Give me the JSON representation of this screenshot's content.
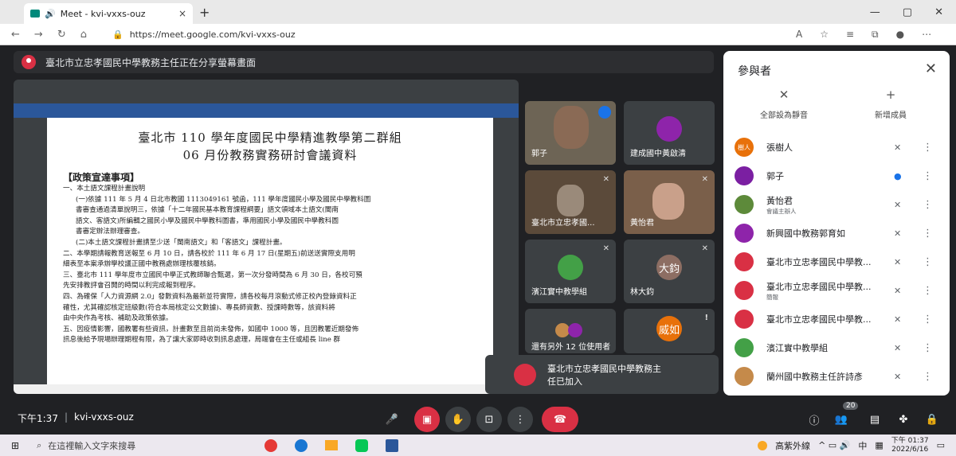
{
  "browser": {
    "tab_title": "Meet - kvi-vxxs-ouz",
    "url": "https://meet.google.com/kvi-vxxs-ouz"
  },
  "banner": {
    "text": "臺北市立忠孝國民中學教務主任正在分享螢幕畫面"
  },
  "document": {
    "title1": "臺北市 110 學年度國民中學精進教學第二群組",
    "title2": "06 月份教務實務研討會議資料",
    "heading": "【政策宣達事項】",
    "lines": [
      "一、本土語文課程計畫說明",
      "(一)依據 111 年 5 月 4 日北市教國 1113049161 號函，111 學年度國民小學及國民中學教科圖",
      "書審查通過清單說明三，依據「十二年國民基本教育課程綱要」語文領域本土語文(閩南",
      "語文、客語文)所編輯之國民小學及國民中學教科圖書，準用國民小學及國民中學教科圖",
      "書審定辦法辦理審查。",
      "(二)本土語文課程計畫請至少送「閩南語文」和「客語文」課程計畫。",
      "二、本學期請報教育送報至 6 月 10 日，請各校於 111 年 6 月 17 日(星期五)前送送實際支用明",
      "細表至本案承辦學校議正國中教務處辦理核覆核銷。",
      "三、臺北市 111 學年度市立國民中學正式教師聯合甄選，第一次分發時間為 6 月 30 日，各校可預",
      "先安排教評會召開的時間以利完成報到程序。",
      "四、為確保「人力資源網 2.0」發數資料為最新並符實際，請各校每月滾動式修正校內登錄資料正",
      "確性，尤其確認核定班級數(符合本局核定公文數據)、專長師資數、授課時數等，該資料將",
      "由中央作為考核、補助及政策依據。",
      "五、因疫情影響，國教署有些資訊，計畫數至且前尚未發佈，如國中 1000 等，且因教署近期發佈",
      "訊息後給予現場辦理期程有限，為了讓大家即時收到訊息處理，局端會在主任或組長 line 群"
    ]
  },
  "tiles": [
    {
      "name": "郭子",
      "avatar": ""
    },
    {
      "name": "建成國中黃啟清",
      "avatar": ""
    },
    {
      "name": "臺北市立忠孝國...",
      "avatar": ""
    },
    {
      "name": "黃怡君",
      "avatar": ""
    },
    {
      "name": "濱江實中教學組",
      "avatar": ""
    },
    {
      "name": "林大鈞",
      "avatar": "大鈞"
    },
    {
      "name": "還有另外 12 位使用者",
      "avatar": ""
    },
    {
      "name": "",
      "avatar": "威如"
    }
  ],
  "toast": {
    "text1": "臺北市立忠孝國民中學教務主",
    "text2": "任已加入"
  },
  "panel": {
    "title": "參與者",
    "mute_all": "全部設為靜音",
    "add_member": "新增成員",
    "participants": [
      {
        "name": "張樹人",
        "sub": "",
        "avatar": "樹人",
        "color": "#e8710a"
      },
      {
        "name": "郭子",
        "sub": "",
        "avatar": "",
        "color": "#7b1fa2"
      },
      {
        "name": "黃怡君",
        "sub": "會議主辦人",
        "avatar": "",
        "color": "#5d8a3a"
      },
      {
        "name": "新興國中教務郭育如",
        "sub": "",
        "avatar": "",
        "color": "#8e24aa"
      },
      {
        "name": "臺北市立忠孝國民中學教...",
        "sub": "",
        "avatar": "",
        "color": "#d93044"
      },
      {
        "name": "臺北市立忠孝國民中學教...",
        "sub": "簡報",
        "avatar": "",
        "color": "#d93044"
      },
      {
        "name": "臺北市立忠孝國民中學教...",
        "sub": "",
        "avatar": "",
        "color": "#d93044"
      },
      {
        "name": "濱江實中教學組",
        "sub": "",
        "avatar": "",
        "color": "#43a047"
      },
      {
        "name": "蘭州國中教務主任許詩彥",
        "sub": "",
        "avatar": "",
        "color": "#c58a4a"
      }
    ]
  },
  "bottom": {
    "time": "下午1:37",
    "meeting_code": "kvi-vxxs-ouz",
    "people_badge": "20"
  },
  "taskbar": {
    "search_placeholder": "在這裡輸入文字來搜尋",
    "weather": "高紫外線",
    "ime": "中",
    "time": "下午 01:37",
    "date": "2022/6/16"
  }
}
